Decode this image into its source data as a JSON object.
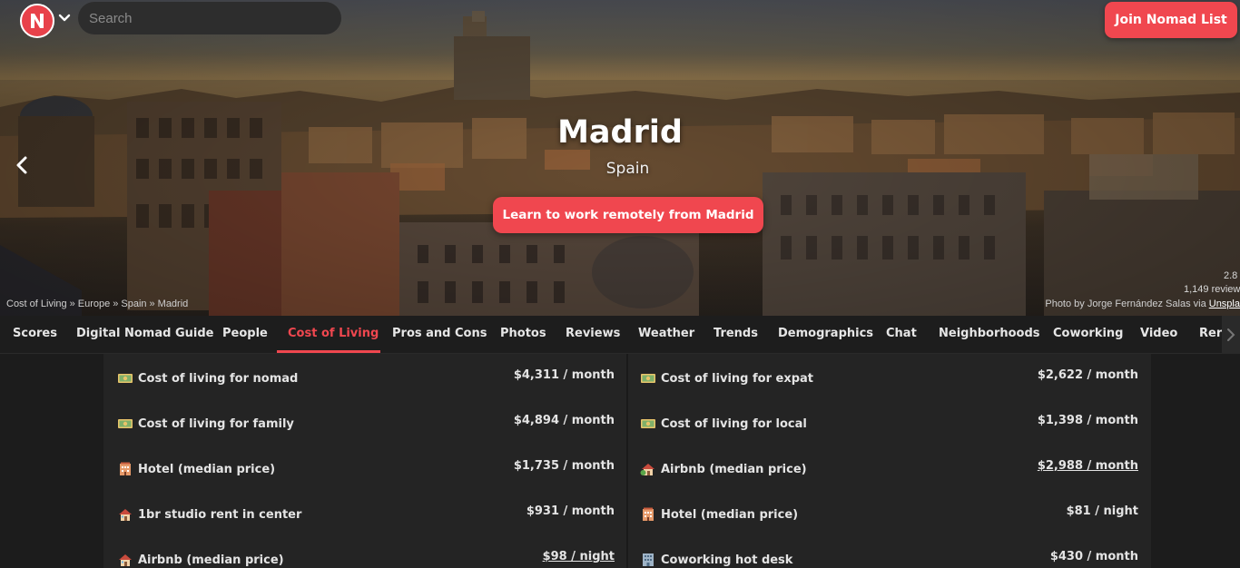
{
  "header": {
    "search_placeholder": "Search",
    "join_label": "Join Nomad List"
  },
  "hero": {
    "city": "Madrid",
    "country": "Spain",
    "cta_label": "Learn to work remotely from Madrid",
    "breadcrumbs": [
      "Cost of Living",
      "Europe",
      "Spain",
      "Madrid"
    ],
    "breadcrumb_sep": "»",
    "score_partial": "2.8",
    "reviews_partial": "1,149 review",
    "credit_prefix": "Photo by Jorge Fernández Salas via ",
    "credit_link": "Unspla"
  },
  "tabs": [
    {
      "label": "Scores",
      "active": false
    },
    {
      "label": "Digital Nomad Guide",
      "active": false
    },
    {
      "label": "People",
      "active": false
    },
    {
      "label": "Cost of Living",
      "active": true
    },
    {
      "label": "Pros and Cons",
      "active": false
    },
    {
      "label": "Photos",
      "active": false
    },
    {
      "label": "Reviews",
      "active": false
    },
    {
      "label": "Weather",
      "active": false
    },
    {
      "label": "Trends",
      "active": false
    },
    {
      "label": "Demographics",
      "active": false
    },
    {
      "label": "Chat",
      "active": false
    },
    {
      "label": "Neighborhoods",
      "active": false
    },
    {
      "label": "Coworking",
      "active": false
    },
    {
      "label": "Video",
      "active": false
    },
    {
      "label": "Rer",
      "active": false
    }
  ],
  "costs": {
    "left": [
      {
        "icon": "money-icon",
        "label": "Cost of living for nomad",
        "value": "$4,311 / month",
        "link": false
      },
      {
        "icon": "money-icon",
        "label": "Cost of living for family",
        "value": "$4,894 / month",
        "link": false
      },
      {
        "icon": "hotel-icon",
        "label": "Hotel (median price)",
        "value": "$1,735 / month",
        "link": false
      },
      {
        "icon": "house-icon",
        "label": "1br studio rent in center",
        "value": "$931 / month",
        "link": false
      },
      {
        "icon": "house-icon",
        "label": "Airbnb (median price)",
        "value": "$98 / night",
        "link": true
      }
    ],
    "right": [
      {
        "icon": "money-icon",
        "label": "Cost of living for expat",
        "value": "$2,622 / month",
        "link": false
      },
      {
        "icon": "money-icon",
        "label": "Cost of living for local",
        "value": "$1,398 / month",
        "link": false
      },
      {
        "icon": "house-garden-icon",
        "label": "Airbnb (median price)",
        "value": "$2,988 / month",
        "link": true
      },
      {
        "icon": "hotel-icon",
        "label": "Hotel (median price)",
        "value": "$81 / night",
        "link": false
      },
      {
        "icon": "office-icon",
        "label": "Coworking hot desk",
        "value": "$430 / month",
        "link": false
      }
    ]
  },
  "colors": {
    "accent": "#f0474f",
    "panel": "#242424",
    "background": "#1c1c1c"
  }
}
